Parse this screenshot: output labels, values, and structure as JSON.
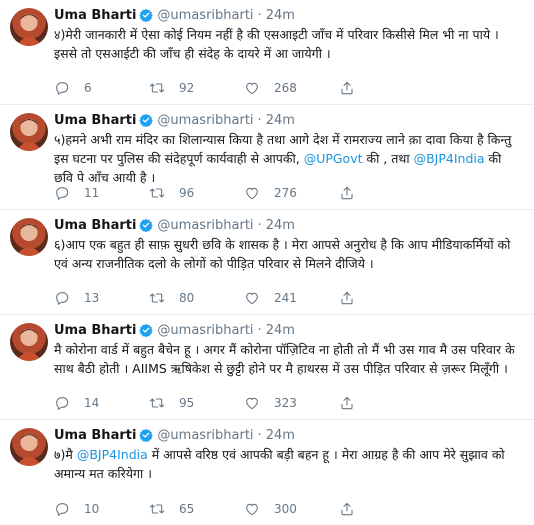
{
  "tweets": [
    {
      "name": "Uma Bharti",
      "handle": "@umasribharti",
      "separator": "·",
      "time": "24m",
      "text_parts": [
        "४)मेरी जानकारी में ऐसा कोई नियम नहीं है की एसआइटी जाँच में परिवार किसीसे मिल भी ना पाये । इससे तो एसआईटी की जाँच ही संदेह के दायरे में आ जायेगी ।"
      ],
      "replies": "6",
      "retweets": "92",
      "likes": "268"
    },
    {
      "name": "Uma Bharti",
      "handle": "@umasribharti",
      "separator": "·",
      "time": "24m",
      "text_parts": [
        "५)हमने अभी राम मंदिर का शिलान्यास किया है तथा आगे देश में रामराज्य लाने क़ा दावा किया है किन्तु इस घटना पर पुलिस की संदेहपूर्ण कार्यवाही से आपकी, ",
        "@UPGovt",
        " की , तथा ",
        "@BJP4India",
        " की छवि पे आँच आयी है ।"
      ],
      "replies": "11",
      "retweets": "96",
      "likes": "276"
    },
    {
      "name": "Uma Bharti",
      "handle": "@umasribharti",
      "separator": "·",
      "time": "24m",
      "text_parts": [
        "६)आप एक बहुत ही साफ़ सुधरी छवि के शासक है । मेरा आपसे अनुरोध है कि आप मीडियाकर्मियों को एवं अन्य राजनीतिक दलो के लोगों को पीड़ित परिवार से मिलने दीजिये ।"
      ],
      "replies": "13",
      "retweets": "80",
      "likes": "241"
    },
    {
      "name": "Uma Bharti",
      "handle": "@umasribharti",
      "separator": "·",
      "time": "24m",
      "text_parts": [
        "मै कोरोना वार्ड में बहुत बैचेन हू । अगर मैं कोरोना पॉज़िटिव ना होती तो मैं भी उस गाव मै उस परिवार के साथ बैठी होती । AIIMS ऋषिकेश से छुट्टी होने पर मै हाथरस में उस पीड़ित परिवार से ज़रूर मिलूँगी ।"
      ],
      "replies": "14",
      "retweets": "95",
      "likes": "323"
    },
    {
      "name": "Uma Bharti",
      "handle": "@umasribharti",
      "separator": "·",
      "time": "24m",
      "text_parts": [
        "७)मै ",
        "@BJP4India",
        " में आपसे वरिष्ठ एवं आपकी बड़ी बहन हू । मेरा आग्रह है की आप मेरे सुझाव को अमान्य मत करियेगा ।"
      ],
      "replies": "10",
      "retweets": "65",
      "likes": "300"
    }
  ],
  "colors": {
    "text": "#14171a",
    "muted": "#657786",
    "link": "#1b95e0",
    "verified": "#1da1f2",
    "divider": "#e6ecf0"
  },
  "icons": {
    "verified": "verified-badge-icon",
    "reply": "reply-icon",
    "retweet": "retweet-icon",
    "like": "heart-icon",
    "share": "share-icon"
  }
}
